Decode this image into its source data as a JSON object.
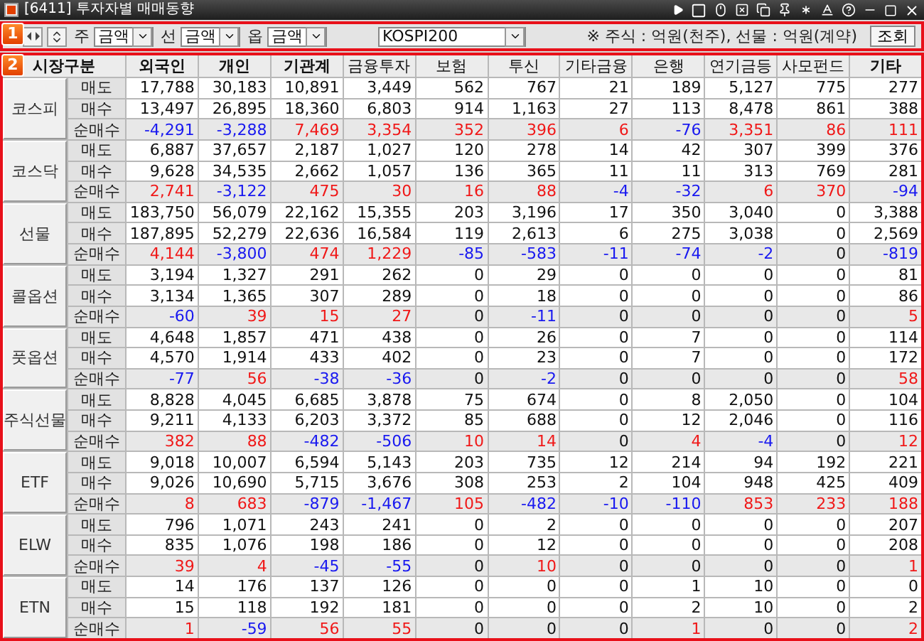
{
  "window": {
    "title": "[6411] 투자자별 매매동향"
  },
  "panel_badges": [
    "1",
    "2"
  ],
  "toolbar": {
    "selects": [
      {
        "label": "주",
        "value": "금액"
      },
      {
        "label": "선",
        "value": "금액"
      },
      {
        "label": "옵",
        "value": "금액"
      }
    ],
    "index_combo": {
      "value": "KOSPI200"
    },
    "unit_note": "※  주식 : 억원(천주), 선물 : 억원(계약)",
    "search_button": "조회"
  },
  "table": {
    "corner": "시장구분",
    "columns": [
      {
        "label": "외국인",
        "bold": true
      },
      {
        "label": "개인",
        "bold": true
      },
      {
        "label": "기관계",
        "bold": true
      },
      {
        "label": "금융투자",
        "bold": false
      },
      {
        "label": "보험",
        "bold": false
      },
      {
        "label": "투신",
        "bold": false
      },
      {
        "label": "기타금융",
        "bold": false
      },
      {
        "label": "은행",
        "bold": false
      },
      {
        "label": "연기금등",
        "bold": false
      },
      {
        "label": "사모펀드",
        "bold": false
      },
      {
        "label": "기타",
        "bold": true
      }
    ],
    "groups": [
      {
        "market": "코스피",
        "rows": [
          {
            "label": "매도",
            "kind": "trade",
            "cells": [
              "17,788",
              "30,183",
              "10,891",
              "3,449",
              "562",
              "767",
              "21",
              "189",
              "5,127",
              "775",
              "277"
            ]
          },
          {
            "label": "매수",
            "kind": "trade",
            "cells": [
              "13,497",
              "26,895",
              "18,360",
              "6,803",
              "914",
              "1,163",
              "27",
              "113",
              "8,478",
              "861",
              "388"
            ]
          },
          {
            "label": "순매수",
            "kind": "net",
            "cells": [
              {
                "text": "-4,291",
                "color": "#1818f0"
              },
              {
                "text": "-3,288",
                "color": "#1818f0"
              },
              {
                "text": "7,469",
                "color": "#f01818"
              },
              {
                "text": "3,354",
                "color": "#f01818"
              },
              {
                "text": "352",
                "color": "#f01818"
              },
              {
                "text": "396",
                "color": "#f01818"
              },
              {
                "text": "6",
                "color": "#f01818"
              },
              {
                "text": "-76",
                "color": "#1818f0"
              },
              {
                "text": "3,351",
                "color": "#f01818"
              },
              {
                "text": "86",
                "color": "#f01818"
              },
              {
                "text": "111",
                "color": "#f01818"
              }
            ]
          }
        ]
      },
      {
        "market": "코스닥",
        "rows": [
          {
            "label": "매도",
            "kind": "trade",
            "cells": [
              "6,887",
              "37,657",
              "2,187",
              "1,027",
              "120",
              "278",
              "14",
              "42",
              "307",
              "399",
              "376"
            ]
          },
          {
            "label": "매수",
            "kind": "trade",
            "cells": [
              "9,628",
              "34,535",
              "2,662",
              "1,057",
              "136",
              "365",
              "11",
              "11",
              "313",
              "769",
              "281"
            ]
          },
          {
            "label": "순매수",
            "kind": "net",
            "cells": [
              {
                "text": "2,741",
                "color": "#f01818"
              },
              {
                "text": "-3,122",
                "color": "#1818f0"
              },
              {
                "text": "475",
                "color": "#f01818"
              },
              {
                "text": "30",
                "color": "#f01818"
              },
              {
                "text": "16",
                "color": "#f01818"
              },
              {
                "text": "88",
                "color": "#f01818"
              },
              {
                "text": "-4",
                "color": "#1818f0"
              },
              {
                "text": "-32",
                "color": "#1818f0"
              },
              {
                "text": "6",
                "color": "#f01818"
              },
              {
                "text": "370",
                "color": "#f01818"
              },
              {
                "text": "-94",
                "color": "#1818f0"
              }
            ]
          }
        ]
      },
      {
        "market": "선물",
        "rows": [
          {
            "label": "매도",
            "kind": "trade",
            "cells": [
              "183,750",
              "56,079",
              "22,162",
              "15,355",
              "203",
              "3,196",
              "17",
              "350",
              "3,040",
              "0",
              "3,388"
            ]
          },
          {
            "label": "매수",
            "kind": "trade",
            "cells": [
              "187,895",
              "52,279",
              "22,636",
              "16,584",
              "119",
              "2,613",
              "6",
              "275",
              "3,038",
              "0",
              "2,569"
            ]
          },
          {
            "label": "순매수",
            "kind": "net",
            "cells": [
              {
                "text": "4,144",
                "color": "#f01818"
              },
              {
                "text": "-3,800",
                "color": "#1818f0"
              },
              {
                "text": "474",
                "color": "#f01818"
              },
              {
                "text": "1,229",
                "color": "#f01818"
              },
              {
                "text": "-85",
                "color": "#1818f0"
              },
              {
                "text": "-583",
                "color": "#1818f0"
              },
              {
                "text": "-11",
                "color": "#1818f0"
              },
              {
                "text": "-74",
                "color": "#1818f0"
              },
              {
                "text": "-2",
                "color": "#1818f0"
              },
              {
                "text": "0",
                "color": "#111111"
              },
              {
                "text": "-819",
                "color": "#1818f0"
              }
            ]
          }
        ]
      },
      {
        "market": "콜옵션",
        "rows": [
          {
            "label": "매도",
            "kind": "trade",
            "cells": [
              "3,194",
              "1,327",
              "291",
              "262",
              "0",
              "29",
              "0",
              "0",
              "0",
              "0",
              "81"
            ]
          },
          {
            "label": "매수",
            "kind": "trade",
            "cells": [
              "3,134",
              "1,365",
              "307",
              "289",
              "0",
              "18",
              "0",
              "0",
              "0",
              "0",
              "86"
            ]
          },
          {
            "label": "순매수",
            "kind": "net",
            "cells": [
              {
                "text": "-60",
                "color": "#1818f0"
              },
              {
                "text": "39",
                "color": "#f01818"
              },
              {
                "text": "15",
                "color": "#f01818"
              },
              {
                "text": "27",
                "color": "#f01818"
              },
              {
                "text": "0",
                "color": "#111111"
              },
              {
                "text": "-11",
                "color": "#1818f0"
              },
              {
                "text": "0",
                "color": "#111111"
              },
              {
                "text": "0",
                "color": "#111111"
              },
              {
                "text": "0",
                "color": "#111111"
              },
              {
                "text": "0",
                "color": "#111111"
              },
              {
                "text": "5",
                "color": "#f01818"
              }
            ]
          }
        ]
      },
      {
        "market": "풋옵션",
        "rows": [
          {
            "label": "매도",
            "kind": "trade",
            "cells": [
              "4,648",
              "1,857",
              "471",
              "438",
              "0",
              "26",
              "0",
              "7",
              "0",
              "0",
              "114"
            ]
          },
          {
            "label": "매수",
            "kind": "trade",
            "cells": [
              "4,570",
              "1,914",
              "433",
              "402",
              "0",
              "23",
              "0",
              "7",
              "0",
              "0",
              "172"
            ]
          },
          {
            "label": "순매수",
            "kind": "net",
            "cells": [
              {
                "text": "-77",
                "color": "#1818f0"
              },
              {
                "text": "56",
                "color": "#f01818"
              },
              {
                "text": "-38",
                "color": "#1818f0"
              },
              {
                "text": "-36",
                "color": "#1818f0"
              },
              {
                "text": "0",
                "color": "#111111"
              },
              {
                "text": "-2",
                "color": "#1818f0"
              },
              {
                "text": "0",
                "color": "#111111"
              },
              {
                "text": "0",
                "color": "#111111"
              },
              {
                "text": "0",
                "color": "#111111"
              },
              {
                "text": "0",
                "color": "#111111"
              },
              {
                "text": "58",
                "color": "#f01818"
              }
            ]
          }
        ]
      },
      {
        "market": "주식선물",
        "rows": [
          {
            "label": "매도",
            "kind": "trade",
            "cells": [
              "8,828",
              "4,045",
              "6,685",
              "3,878",
              "75",
              "674",
              "0",
              "8",
              "2,050",
              "0",
              "104"
            ]
          },
          {
            "label": "매수",
            "kind": "trade",
            "cells": [
              "9,211",
              "4,133",
              "6,203",
              "3,372",
              "85",
              "688",
              "0",
              "12",
              "2,046",
              "0",
              "116"
            ]
          },
          {
            "label": "순매수",
            "kind": "net",
            "cells": [
              {
                "text": "382",
                "color": "#f01818"
              },
              {
                "text": "88",
                "color": "#f01818"
              },
              {
                "text": "-482",
                "color": "#1818f0"
              },
              {
                "text": "-506",
                "color": "#1818f0"
              },
              {
                "text": "10",
                "color": "#f01818"
              },
              {
                "text": "14",
                "color": "#f01818"
              },
              {
                "text": "0",
                "color": "#111111"
              },
              {
                "text": "4",
                "color": "#f01818"
              },
              {
                "text": "-4",
                "color": "#1818f0"
              },
              {
                "text": "0",
                "color": "#111111"
              },
              {
                "text": "12",
                "color": "#f01818"
              }
            ]
          }
        ]
      },
      {
        "market": "ETF",
        "rows": [
          {
            "label": "매도",
            "kind": "trade",
            "cells": [
              "9,018",
              "10,007",
              "6,594",
              "5,143",
              "203",
              "735",
              "12",
              "214",
              "94",
              "192",
              "221"
            ]
          },
          {
            "label": "매수",
            "kind": "trade",
            "cells": [
              "9,026",
              "10,690",
              "5,715",
              "3,676",
              "308",
              "253",
              "2",
              "104",
              "948",
              "425",
              "409"
            ]
          },
          {
            "label": "순매수",
            "kind": "net",
            "cells": [
              {
                "text": "8",
                "color": "#f01818"
              },
              {
                "text": "683",
                "color": "#f01818"
              },
              {
                "text": "-879",
                "color": "#1818f0"
              },
              {
                "text": "-1,467",
                "color": "#1818f0"
              },
              {
                "text": "105",
                "color": "#f01818"
              },
              {
                "text": "-482",
                "color": "#1818f0"
              },
              {
                "text": "-10",
                "color": "#1818f0"
              },
              {
                "text": "-110",
                "color": "#1818f0"
              },
              {
                "text": "853",
                "color": "#f01818"
              },
              {
                "text": "233",
                "color": "#f01818"
              },
              {
                "text": "188",
                "color": "#f01818"
              }
            ]
          }
        ]
      },
      {
        "market": "ELW",
        "rows": [
          {
            "label": "매도",
            "kind": "trade",
            "cells": [
              "796",
              "1,071",
              "243",
              "241",
              "0",
              "2",
              "0",
              "0",
              "0",
              "0",
              "207"
            ]
          },
          {
            "label": "매수",
            "kind": "trade",
            "cells": [
              "835",
              "1,076",
              "198",
              "186",
              "0",
              "12",
              "0",
              "0",
              "0",
              "0",
              "208"
            ]
          },
          {
            "label": "순매수",
            "kind": "net",
            "cells": [
              {
                "text": "39",
                "color": "#f01818"
              },
              {
                "text": "4",
                "color": "#f01818"
              },
              {
                "text": "-45",
                "color": "#1818f0"
              },
              {
                "text": "-55",
                "color": "#1818f0"
              },
              {
                "text": "0",
                "color": "#111111"
              },
              {
                "text": "10",
                "color": "#f01818"
              },
              {
                "text": "0",
                "color": "#111111"
              },
              {
                "text": "0",
                "color": "#111111"
              },
              {
                "text": "0",
                "color": "#111111"
              },
              {
                "text": "0",
                "color": "#111111"
              },
              {
                "text": "1",
                "color": "#f01818"
              }
            ]
          }
        ]
      },
      {
        "market": "ETN",
        "rows": [
          {
            "label": "매도",
            "kind": "trade",
            "cells": [
              "14",
              "176",
              "137",
              "126",
              "0",
              "0",
              "0",
              "1",
              "10",
              "0",
              "0"
            ]
          },
          {
            "label": "매수",
            "kind": "trade",
            "cells": [
              "15",
              "118",
              "192",
              "181",
              "0",
              "0",
              "0",
              "2",
              "10",
              "0",
              "2"
            ]
          },
          {
            "label": "순매수",
            "kind": "net",
            "cells": [
              {
                "text": "1",
                "color": "#f01818"
              },
              {
                "text": "-59",
                "color": "#1818f0"
              },
              {
                "text": "56",
                "color": "#f01818"
              },
              {
                "text": "55",
                "color": "#f01818"
              },
              {
                "text": "0",
                "color": "#111111"
              },
              {
                "text": "0",
                "color": "#111111"
              },
              {
                "text": "0",
                "color": "#111111"
              },
              {
                "text": "1",
                "color": "#f01818"
              },
              {
                "text": "0",
                "color": "#111111"
              },
              {
                "text": "0",
                "color": "#111111"
              },
              {
                "text": "2",
                "color": "#f01818"
              }
            ]
          }
        ]
      }
    ]
  }
}
